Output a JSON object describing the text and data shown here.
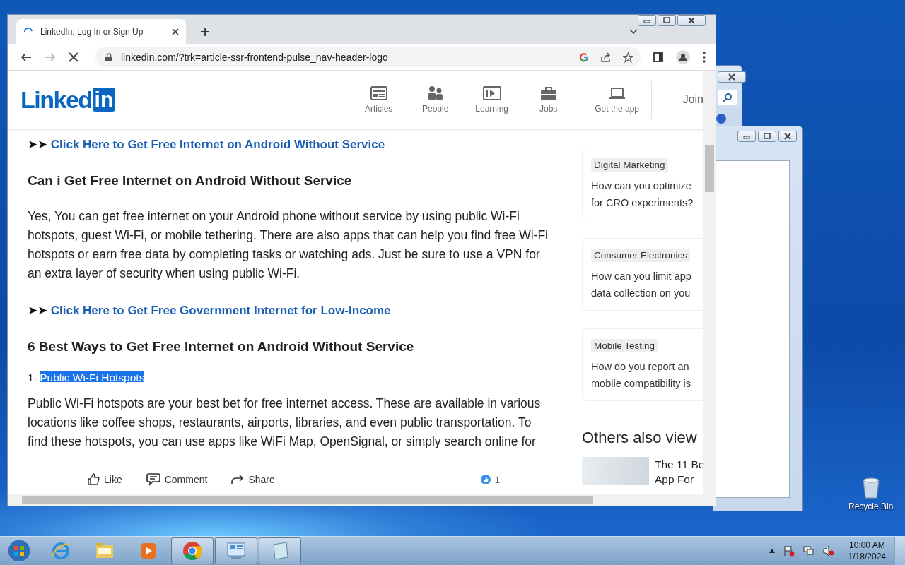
{
  "browser": {
    "tab": {
      "title": "LinkedIn: Log In or Sign Up"
    },
    "url": "linkedin.com/?trk=article-ssr-frontend-pulse_nav-header-logo"
  },
  "header": {
    "logo_text": "Linked",
    "logo_badge": "in",
    "nav": [
      {
        "kind": "articles",
        "label": "Articles"
      },
      {
        "kind": "people",
        "label": "People"
      },
      {
        "kind": "learning",
        "label": "Learning"
      },
      {
        "kind": "jobs",
        "label": "Jobs"
      },
      {
        "kind": "app",
        "label": "Get the app"
      }
    ],
    "join": "Join"
  },
  "article": [
    {
      "kind": "link",
      "marker": "➤➤",
      "text": "Click Here to Get Free Internet on Android Without Service"
    },
    {
      "kind": "heading",
      "text": "Can i Get Free Internet on Android Without Service"
    },
    {
      "kind": "paragraph",
      "text": "Yes, You can get free internet on your Android phone without service by using public Wi-Fi hotspots, guest Wi-Fi, or mobile tethering. There are also apps that can help you find free Wi-Fi hotspots or earn free data by completing tasks or watching ads. Just be sure to use a VPN for an extra layer of security when using public Wi-Fi."
    },
    {
      "kind": "link",
      "marker": "➤➤",
      "text": "Click Here to Get Free Government Internet for Low-Income"
    },
    {
      "kind": "heading",
      "text": "6 Best Ways to Get Free Internet on Android Without Service"
    },
    {
      "kind": "list_item",
      "number": "1.",
      "text": "Public Wi-Fi Hotspots",
      "highlighted": true
    },
    {
      "kind": "paragraph",
      "text": "Public Wi-Fi hotspots are your best bet for free internet access. These are available in various locations like coffee shops, restaurants, airports, libraries, and even public transportation. To find these hotspots, you can use apps like WiFi Map, OpenSignal, or simply search online for"
    }
  ],
  "actions": {
    "like": "Like",
    "comment": "Comment",
    "share": "Share",
    "reactions": "1"
  },
  "sidebar": {
    "cards": [
      {
        "tag": "Digital Marketing",
        "lines": [
          "How can you optimize",
          "for CRO experiments?"
        ]
      },
      {
        "tag": "Consumer Electronics",
        "lines": [
          "How can you limit app",
          "data collection on you"
        ]
      },
      {
        "tag": "Mobile Testing",
        "lines": [
          "How do you report an",
          "mobile compatibility is"
        ]
      }
    ],
    "others_heading": "Others also view",
    "others": [
      {
        "lines": [
          "The 11 Be",
          "App For"
        ]
      }
    ]
  },
  "desktop": {
    "recycle_bin": "Recycle Bin"
  },
  "taskbar": {
    "apps": [
      {
        "kind": "ie",
        "open": false
      },
      {
        "kind": "explorer",
        "open": false
      },
      {
        "kind": "media",
        "open": false
      },
      {
        "kind": "chrome",
        "open": true
      },
      {
        "kind": "control",
        "open": true
      },
      {
        "kind": "notepad",
        "open": true
      }
    ],
    "time": "10:00 AM",
    "date": "1/18/2024"
  }
}
